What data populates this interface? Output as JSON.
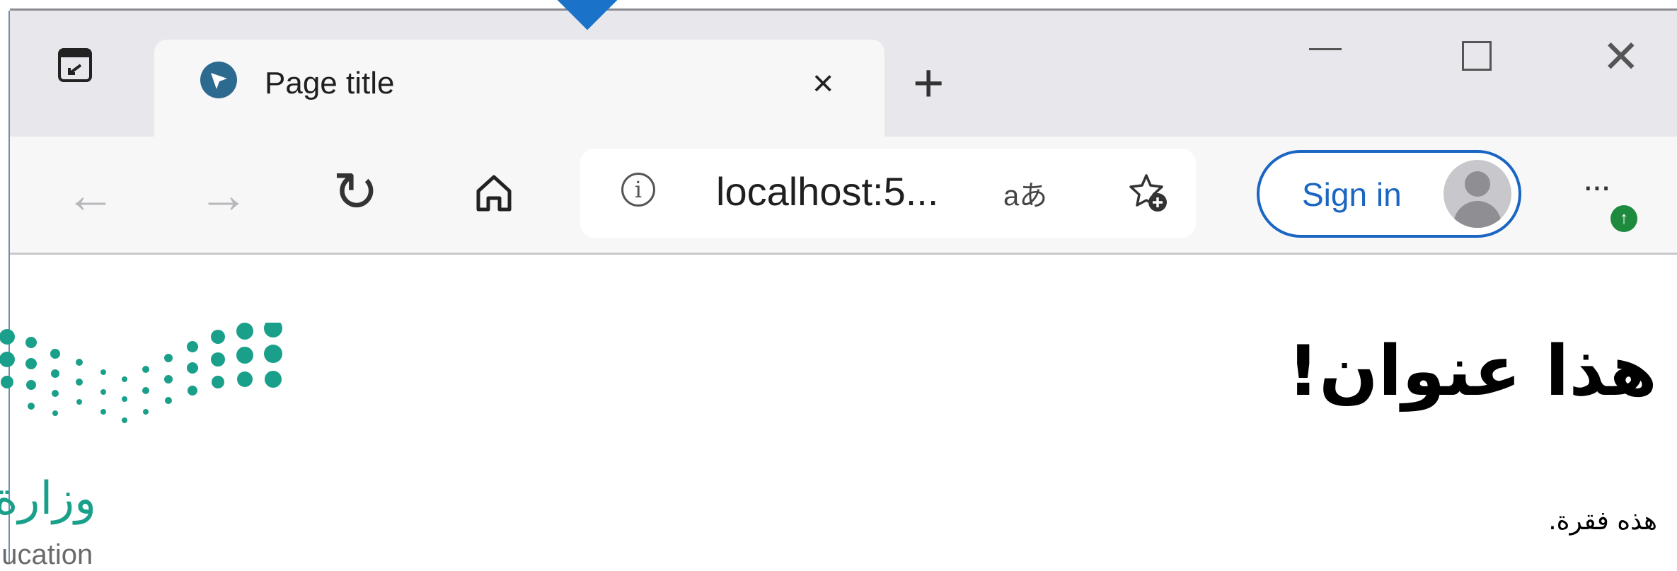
{
  "browser": {
    "tab": {
      "title": "Page title",
      "close_glyph": "×"
    },
    "new_tab_glyph": "+",
    "window_controls": {
      "close_glyph": "✕"
    },
    "nav": {
      "back_glyph": "←",
      "forward_glyph": "→",
      "refresh_glyph": "↻",
      "home_icon": "home-icon"
    },
    "address": {
      "info_glyph": "i",
      "url": "localhost:5...",
      "read_aloud": "aあ"
    },
    "sign_in_label": "Sign in",
    "more_glyph": "···",
    "update_badge": "↑"
  },
  "page": {
    "heading": "هذا عنوان!",
    "paragraph": "هذه فقرة."
  },
  "logo": {
    "arabic_text": "وزارة",
    "english_text": "ducation"
  },
  "colors": {
    "accent_blue": "#1a66c2",
    "logo_teal": "#1aa08a",
    "update_green": "#1e8a3e"
  }
}
